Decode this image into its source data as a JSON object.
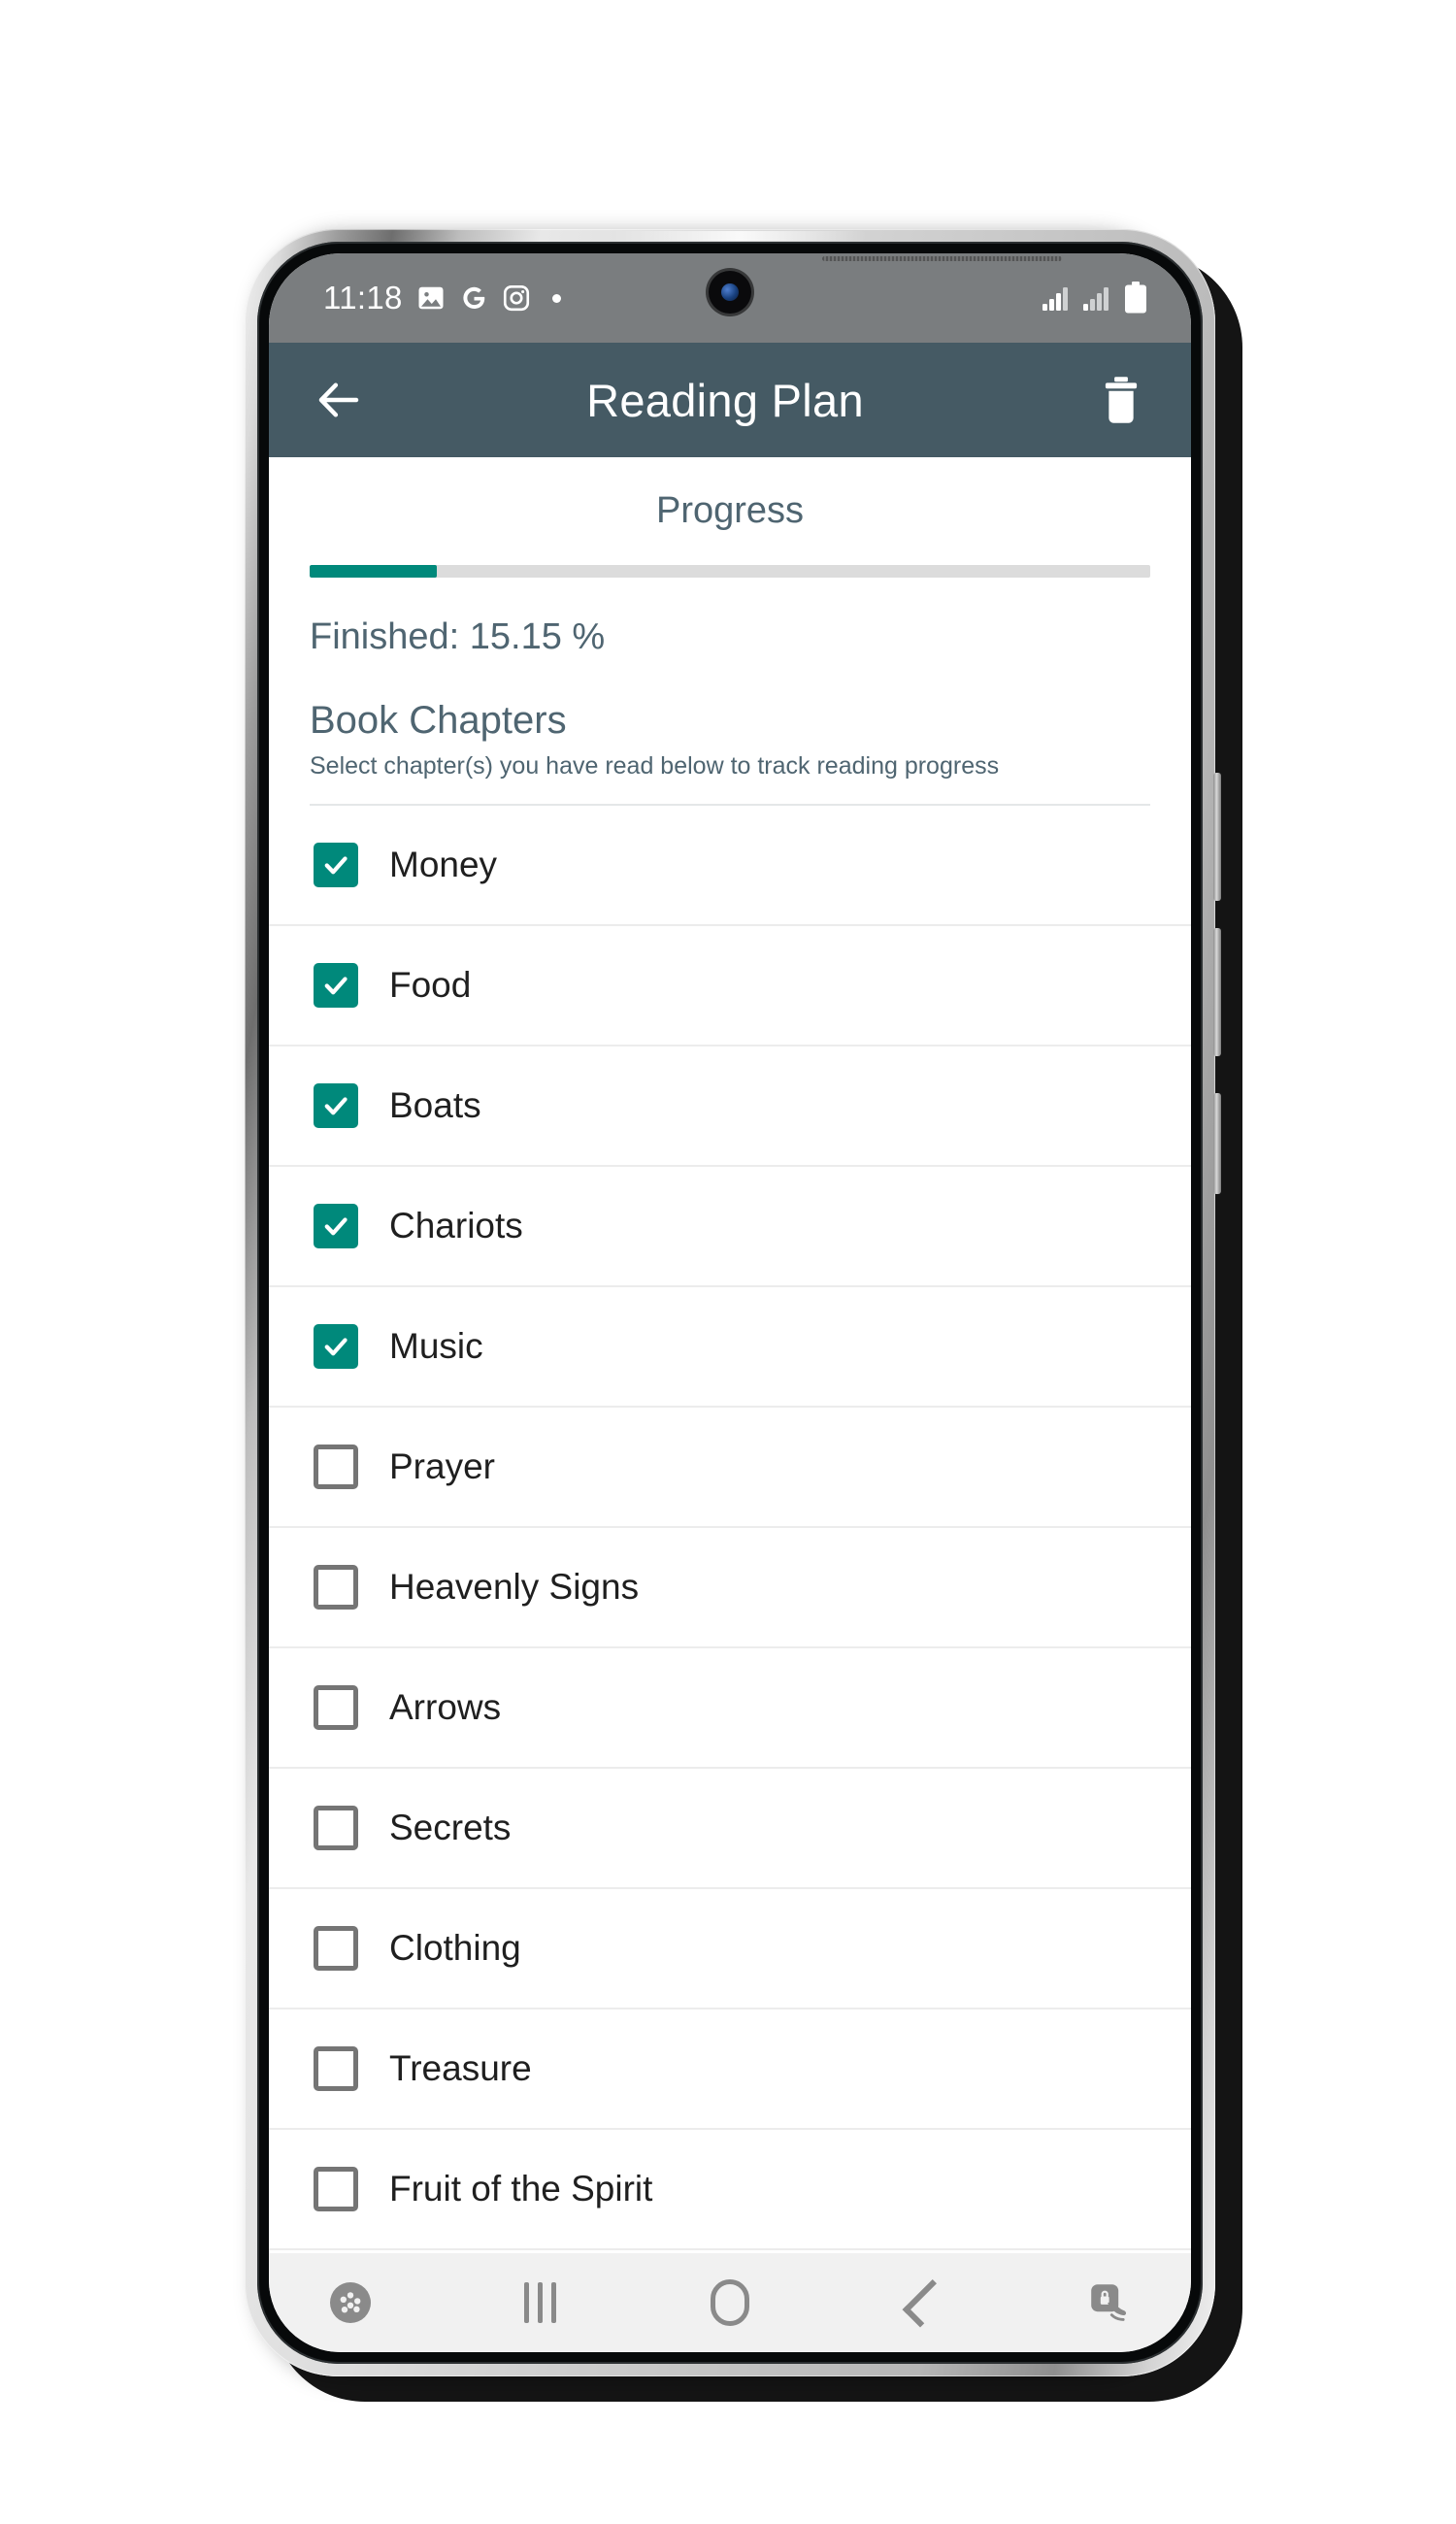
{
  "status_bar": {
    "time": "11:18",
    "left_icons": [
      "photos-icon",
      "google-icon",
      "instagram-icon",
      "dot-indicator-icon"
    ],
    "right_icons": [
      "signal-bars-sim1-icon",
      "signal-bars-sim2-icon",
      "battery-icon"
    ]
  },
  "app_bar": {
    "back_label": "back-arrow-icon",
    "title": "Reading Plan",
    "delete_label": "trash-icon"
  },
  "progress": {
    "label": "Progress",
    "percent": 15.15,
    "percent_text": "Finished: 15.15 %"
  },
  "chapters_section": {
    "heading": "Book Chapters",
    "subtitle": "Select chapter(s) you have read below to track reading progress"
  },
  "chapters": [
    {
      "label": "Money",
      "checked": true
    },
    {
      "label": "Food",
      "checked": true
    },
    {
      "label": "Boats",
      "checked": true
    },
    {
      "label": "Chariots",
      "checked": true
    },
    {
      "label": "Music",
      "checked": true
    },
    {
      "label": "Prayer",
      "checked": false
    },
    {
      "label": "Heavenly Signs",
      "checked": false
    },
    {
      "label": "Arrows",
      "checked": false
    },
    {
      "label": "Secrets",
      "checked": false
    },
    {
      "label": "Clothing",
      "checked": false
    },
    {
      "label": "Treasure",
      "checked": false
    },
    {
      "label": "Fruit of the Spirit",
      "checked": false
    }
  ],
  "nav_bar": {
    "items": [
      {
        "name": "game-booster-icon"
      },
      {
        "name": "recents-icon"
      },
      {
        "name": "home-icon"
      },
      {
        "name": "back-icon"
      },
      {
        "name": "screen-lock-touch-icon"
      }
    ]
  },
  "colors": {
    "app_bar": "#455a64",
    "accent_teal": "#00897b",
    "text_muted": "#4f6571",
    "track": "#dcdcdc",
    "status_bar": "#7a7d7f",
    "nav_bar": "#f1f1f1"
  }
}
